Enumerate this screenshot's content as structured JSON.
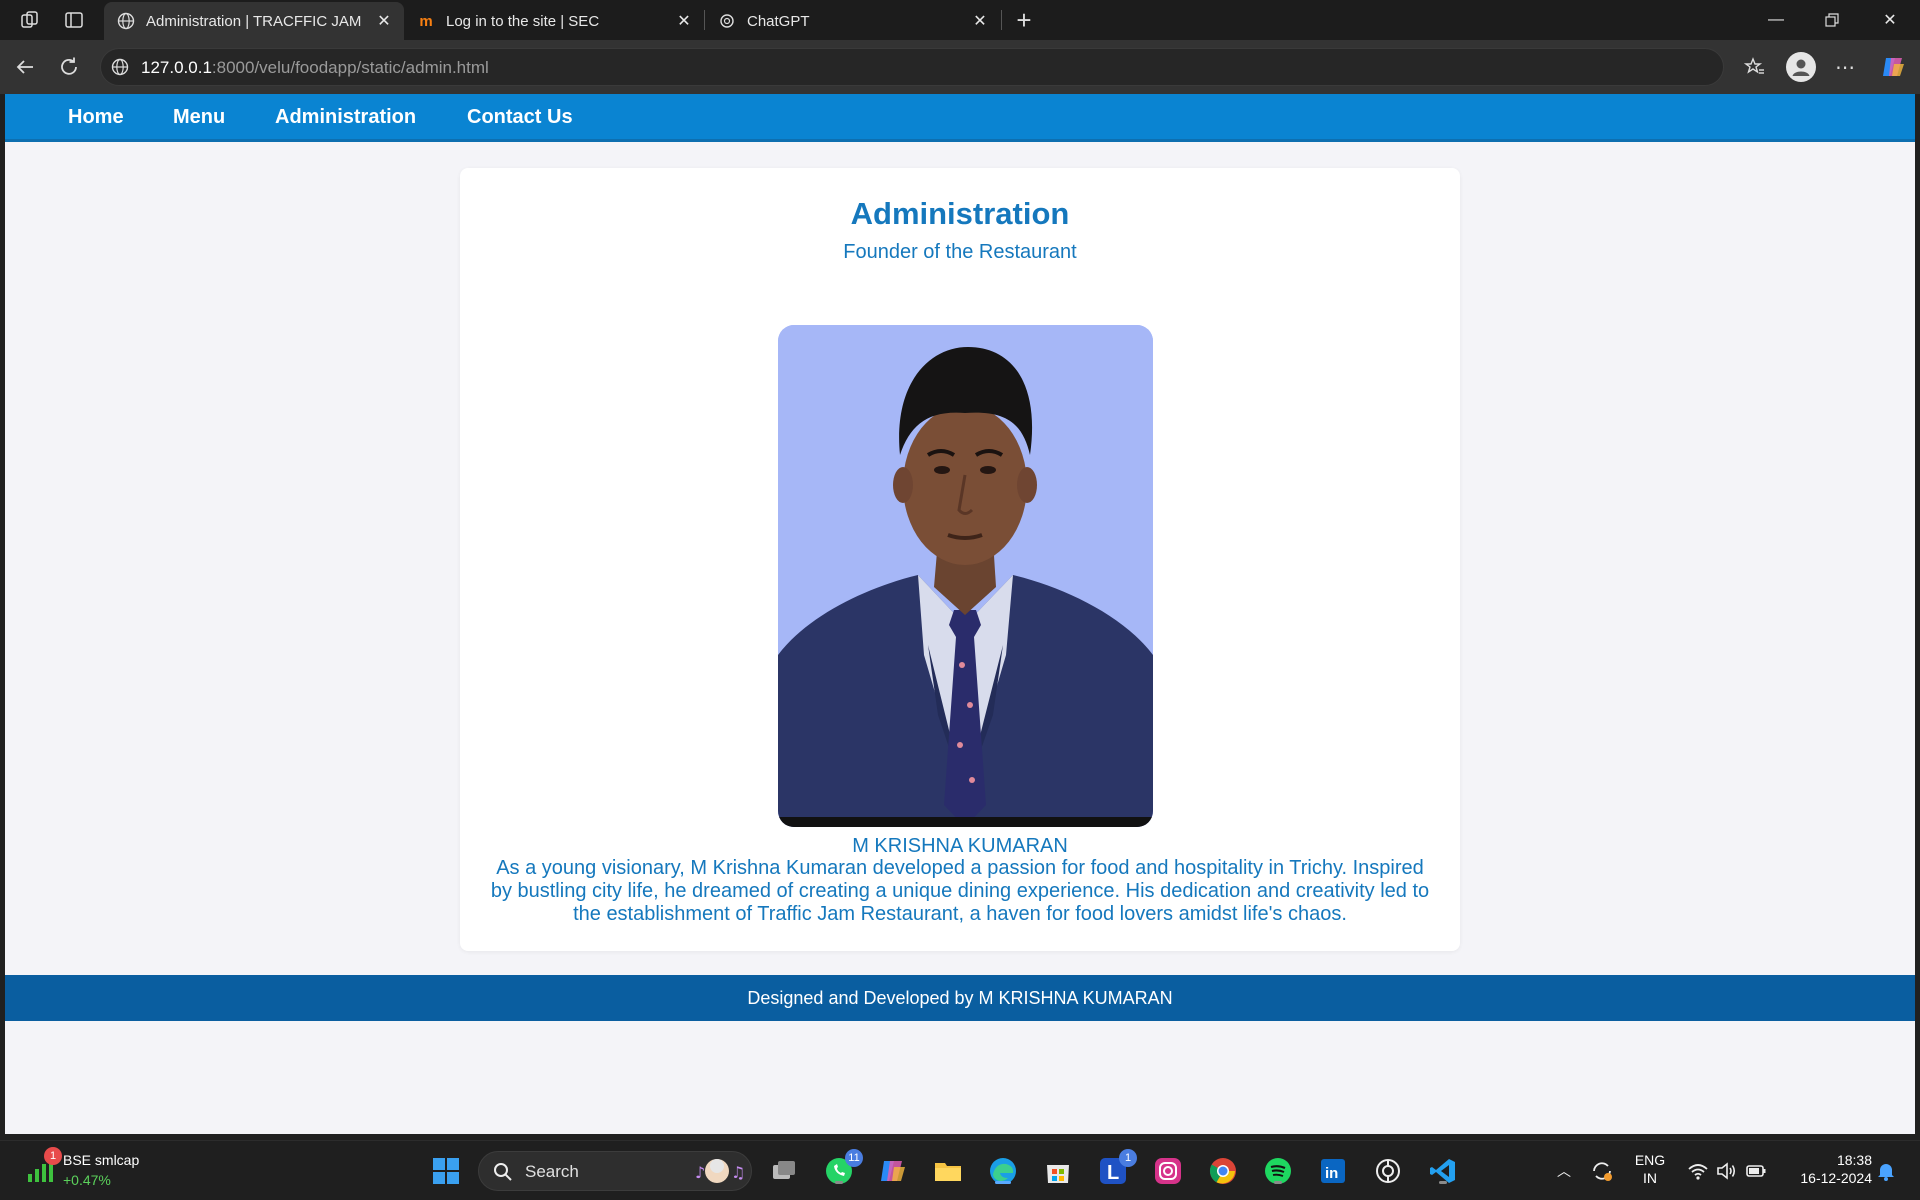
{
  "browser": {
    "tabs": [
      {
        "title": "Administration | TRACFFIC JAM RESTAURANT",
        "active": true
      },
      {
        "title": "Log in to the site | SEC",
        "active": false
      },
      {
        "title": "ChatGPT",
        "active": false
      }
    ],
    "url_host": "127.0.0.1",
    "url_path": ":8000/velu/foodapp/static/admin.html"
  },
  "site": {
    "nav": [
      "Home",
      "Menu",
      "Administration",
      "Contact Us"
    ],
    "title": "Administration",
    "subtitle": "Founder of the Restaurant",
    "person_name": "M KRISHNA KUMARAN",
    "bio": "As a young visionary, M Krishna Kumaran developed a passion for food and hospitality in Trichy. Inspired by bustling city life, he dreamed of creating a unique dining experience. His dedication and creativity led to the establishment of Traffic Jam Restaurant, a haven for food lovers amidst life's chaos.",
    "footer": "Designed and Developed by M KRISHNA KUMARAN",
    "colors": {
      "nav": "#0a84d2",
      "heading": "#1578bd",
      "footer": "#0a5ea0",
      "photo_bg": "#a6b7f7"
    }
  },
  "taskbar": {
    "stock_name": "BSE smlcap",
    "stock_change": "+0.47%",
    "stock_badge": "1",
    "search_label": "Search",
    "whatsapp_badge": "11",
    "l_badge": "1",
    "lang_top": "ENG",
    "lang_bottom": "IN",
    "time": "18:38",
    "date": "16-12-2024",
    "icons": [
      "windows-start-icon",
      "search-icon",
      "task-view-icon",
      "whatsapp-icon",
      "copilot-icon",
      "file-explorer-icon",
      "edge-icon",
      "store-icon",
      "l-app-icon",
      "instagram-icon",
      "chrome-icon",
      "spotify-icon",
      "linkedin-icon",
      "chatgpt-icon",
      "vscode-icon"
    ]
  }
}
